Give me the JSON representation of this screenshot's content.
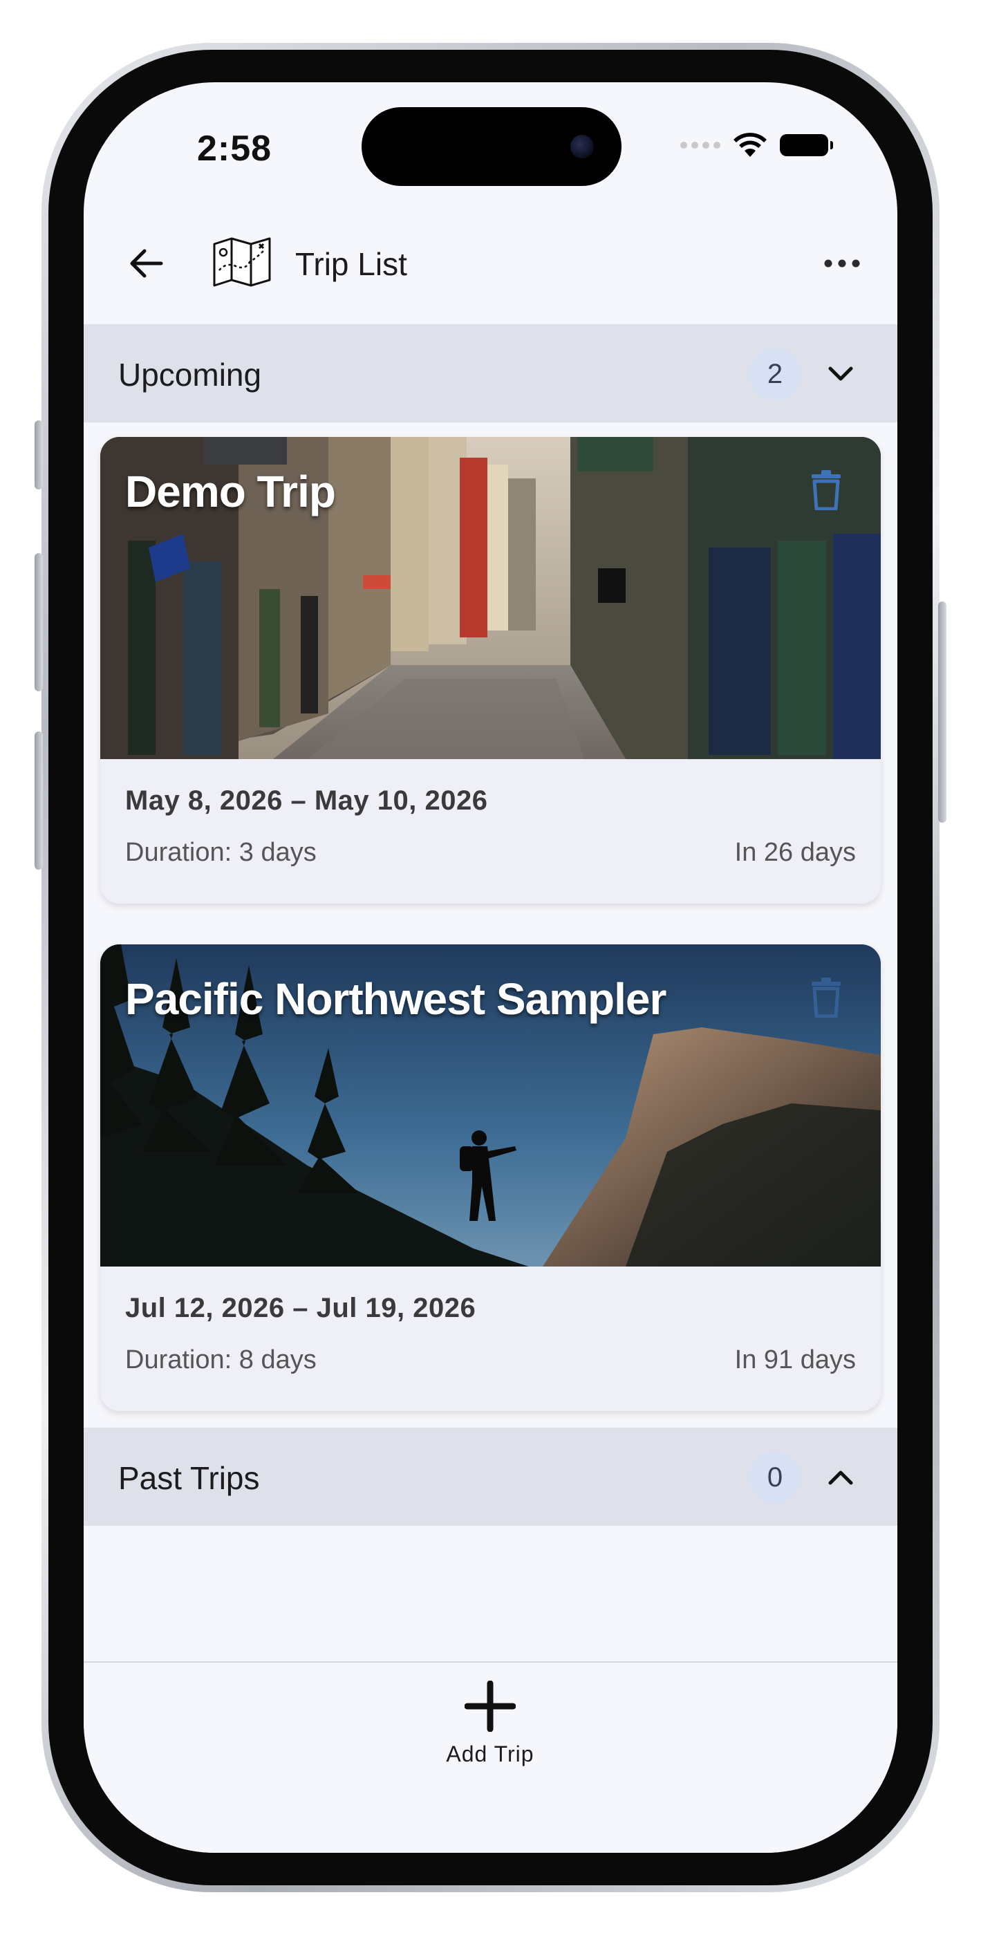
{
  "status_bar": {
    "time": "2:58"
  },
  "app_bar": {
    "title": "Trip List"
  },
  "sections": {
    "upcoming": {
      "title": "Upcoming",
      "count": "2",
      "expanded": true
    },
    "past": {
      "title": "Past Trips",
      "count": "0",
      "expanded": false
    }
  },
  "trips": [
    {
      "name": "Demo Trip",
      "dates": "May 8, 2026 – May 10, 2026",
      "duration": "Duration: 3 days",
      "countdown": "In 26 days"
    },
    {
      "name": "Pacific Northwest Sampler",
      "dates": "Jul 12, 2026 – Jul 19, 2026",
      "duration": "Duration: 8 days",
      "countdown": "In 91 days"
    }
  ],
  "bottom_bar": {
    "add_label": "Add Trip"
  },
  "colors": {
    "section_bg": "#dfe1ea",
    "badge_bg": "#d7e1f3",
    "card_bg": "#eff0f7",
    "screen_bg": "#f6f7fc",
    "delete_icon": "#3f73b8"
  },
  "icons": {
    "back": "arrow-left-icon",
    "map": "map-icon",
    "more": "more-horizontal-icon",
    "delete": "trash-icon",
    "add": "plus-icon"
  }
}
